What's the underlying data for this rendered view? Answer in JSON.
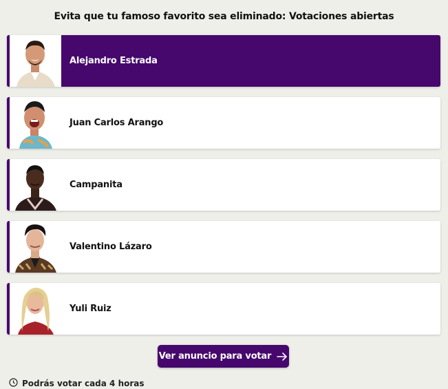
{
  "header": {
    "title": "Evita que tu famoso favorito sea eliminado: Votaciones abiertas"
  },
  "contestants": [
    {
      "name": "Alejandro Estrada",
      "selected": true
    },
    {
      "name": "Juan Carlos Arango",
      "selected": false
    },
    {
      "name": "Campanita",
      "selected": false
    },
    {
      "name": "Valentino Lázaro",
      "selected": false
    },
    {
      "name": "Yuli Ruiz",
      "selected": false
    }
  ],
  "vote_button": {
    "label": "Ver anuncio para votar",
    "icon": "arrow-right-icon"
  },
  "footer": {
    "info_text": "Podrás votar cada 4 horas",
    "icon": "clock-icon"
  },
  "colors": {
    "accent": "#46086d",
    "background": "#efefea",
    "card": "#ffffff"
  }
}
